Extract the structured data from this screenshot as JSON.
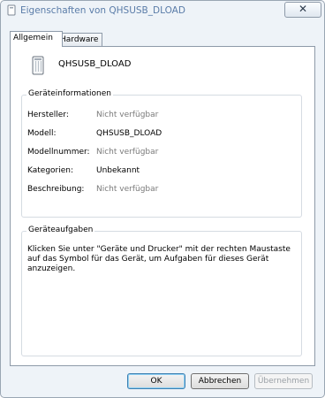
{
  "window": {
    "title": "Eigenschaften von QHSUSB_DLOAD",
    "close_label": "✕"
  },
  "tabs": [
    {
      "label": "Allgemein",
      "selected": true
    },
    {
      "label": "Hardware",
      "selected": false
    }
  ],
  "device": {
    "name": "QHSUSB_DLOAD",
    "icon": "usb-device-icon"
  },
  "info": {
    "title": "Geräteinformationen",
    "rows": [
      {
        "label": "Hersteller:",
        "value": "Nicht verfügbar"
      },
      {
        "label": "Modell:",
        "value": "QHSUSB_DLOAD"
      },
      {
        "label": "Modellnummer:",
        "value": "Nicht verfügbar"
      },
      {
        "label": "Kategorien:",
        "value": "Unbekannt"
      },
      {
        "label": "Beschreibung:",
        "value": "Nicht verfügbar"
      }
    ]
  },
  "tasks": {
    "title": "Geräteaufgaben",
    "text": "Klicken Sie unter \"Geräte und Drucker\" mit der rechten Maustaste auf das Symbol für das Gerät, um Aufgaben für dieses Gerät anzuzeigen."
  },
  "buttons": {
    "ok": "OK",
    "cancel": "Abbrechen",
    "apply": "Übernehmen"
  },
  "colors": {
    "title_text": "#5a7ca8",
    "disabled_text": "#9aa0a6",
    "gray_value": "#7a7a7a"
  }
}
